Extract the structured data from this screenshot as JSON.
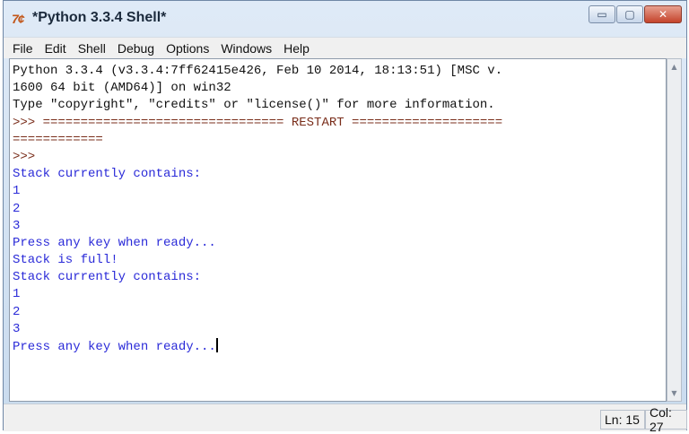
{
  "window": {
    "icon_text": "7¢",
    "title": "*Python 3.3.4 Shell*",
    "controls": {
      "minimize": "▭",
      "maximize": "▢",
      "close": "✕"
    }
  },
  "menu": [
    "File",
    "Edit",
    "Shell",
    "Debug",
    "Options",
    "Windows",
    "Help"
  ],
  "lines": [
    {
      "text": "Python 3.3.4 (v3.3.4:7ff62415e426, Feb 10 2014, 18:13:51) [MSC v.",
      "color": "black"
    },
    {
      "text": "1600 64 bit (AMD64)] on win32",
      "color": "black"
    },
    {
      "text": "Type \"copyright\", \"credits\" or \"license()\" for more information.",
      "color": "black"
    },
    {
      "text": ">>> ================================ RESTART ====================",
      "color": "brown"
    },
    {
      "text": "============",
      "color": "brown"
    },
    {
      "text": ">>>",
      "color": "brown"
    },
    {
      "text": "Stack currently contains:",
      "color": "blue"
    },
    {
      "text": "1",
      "color": "blue"
    },
    {
      "text": "2",
      "color": "blue"
    },
    {
      "text": "3",
      "color": "blue"
    },
    {
      "text": "Press any key when ready...",
      "color": "blue"
    },
    {
      "text": "Stack is full!",
      "color": "blue"
    },
    {
      "text": "Stack currently contains:",
      "color": "blue"
    },
    {
      "text": "1",
      "color": "blue"
    },
    {
      "text": "2",
      "color": "blue"
    },
    {
      "text": "3",
      "color": "blue"
    },
    {
      "text": "Press any key when ready...",
      "color": "blue",
      "cursor": true
    }
  ],
  "status": {
    "line": "Ln: 15",
    "col": "Col: 27"
  },
  "colors": {
    "prompt": "#7a2e1b",
    "output": "#2a2ad8",
    "text": "#111111"
  }
}
